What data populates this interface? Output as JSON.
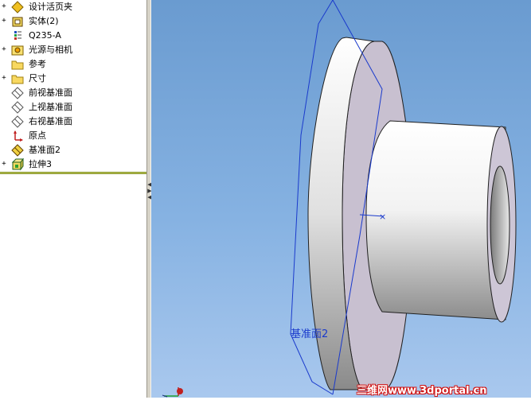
{
  "feature_tree": {
    "items": [
      {
        "label": "设计活页夹",
        "expander": "+",
        "icon": "design-binder-icon"
      },
      {
        "label": "实体(2)",
        "expander": "+",
        "icon": "solid-bodies-icon"
      },
      {
        "label": "Q235-A",
        "expander": "",
        "icon": "material-icon"
      },
      {
        "label": "光源与相机",
        "expander": "+",
        "icon": "lights-cameras-icon"
      },
      {
        "label": "参考",
        "expander": "",
        "icon": "folder-icon"
      },
      {
        "label": "尺寸",
        "expander": "+",
        "icon": "folder-icon"
      },
      {
        "label": "前视基准面",
        "expander": "",
        "icon": "plane-icon"
      },
      {
        "label": "上视基准面",
        "expander": "",
        "icon": "plane-icon"
      },
      {
        "label": "右视基准面",
        "expander": "",
        "icon": "plane-icon"
      },
      {
        "label": "原点",
        "expander": "",
        "icon": "origin-icon"
      },
      {
        "label": "基准面2",
        "expander": "",
        "icon": "plane-selected-icon"
      },
      {
        "label": "拉伸3",
        "expander": "+",
        "icon": "extrude-icon"
      }
    ]
  },
  "viewport": {
    "plane_label": "基准面2",
    "watermark": "三维网www.3dportal.cn",
    "colors": {
      "plane_outline": "#1a3acc",
      "part_face": "#ffffff",
      "background_top": "#6a9bd0"
    }
  }
}
